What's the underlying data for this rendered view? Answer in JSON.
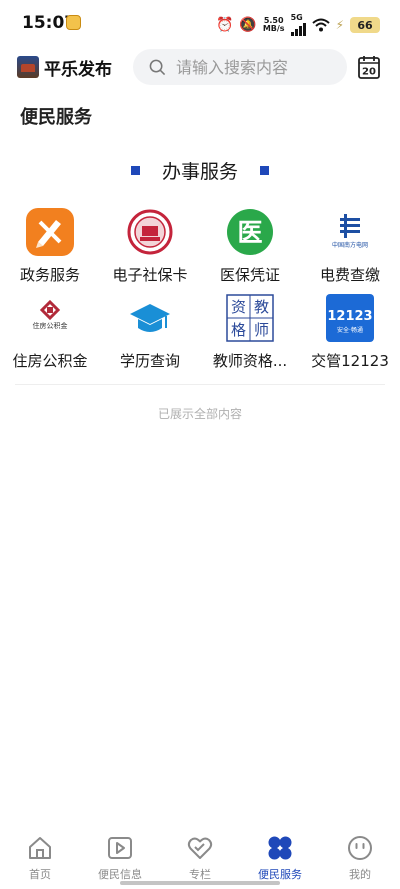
{
  "status_bar": {
    "time": "15:07",
    "net_speed": "5.50",
    "net_unit": "MB/s",
    "network_type": "5G",
    "battery": "66",
    "icons": [
      "alarm-icon",
      "mute-icon",
      "signal-icon",
      "wifi-icon",
      "battery-icon"
    ]
  },
  "header": {
    "brand": "平乐发布",
    "search_placeholder": "请输入搜索内容",
    "calendar_day": "20"
  },
  "page": {
    "section_title": "便民服务",
    "service_heading": "办事服务",
    "footer_note": "已展示全部内容"
  },
  "services": [
    {
      "label": "政务服务",
      "icon": "pen-ruler-icon",
      "color": "#f2801f"
    },
    {
      "label": "电子社保卡",
      "icon": "social-security-seal-icon",
      "color": "#c4243b"
    },
    {
      "label": "医保凭证",
      "icon": "medical-insurance-icon",
      "color": "#2aa84a",
      "glyph": "医"
    },
    {
      "label": "电费查缴",
      "icon": "china-southern-grid-icon",
      "color": "#1d4fa3",
      "caption": "中国南方电网"
    },
    {
      "label": "住房公积金",
      "icon": "housing-fund-icon",
      "color": "#b22a3a",
      "caption": "住房公积金"
    },
    {
      "label": "学历查询",
      "icon": "graduation-cap-icon",
      "color": "#1a8fd6"
    },
    {
      "label": "教师资格...",
      "icon": "teacher-qualification-icon",
      "color": "#2c4a9a",
      "glyph_chars": [
        "资",
        "教",
        "格",
        "师"
      ]
    },
    {
      "label": "交管12123",
      "icon": "traffic-12123-icon",
      "color": "#1c6ad6",
      "glyph": "12123",
      "caption": "安全·畅通"
    }
  ],
  "tabs": [
    {
      "label": "首页",
      "icon": "home-icon",
      "active": false
    },
    {
      "label": "便民信息",
      "icon": "play-icon",
      "active": false
    },
    {
      "label": "专栏",
      "icon": "heart-icon",
      "active": false
    },
    {
      "label": "便民服务",
      "icon": "clover-icon",
      "active": true
    },
    {
      "label": "我的",
      "icon": "smile-icon",
      "active": false
    }
  ],
  "colors": {
    "accent": "#1f48b9",
    "search_bg": "#f2f3f5",
    "inactive": "#8a8a8a"
  }
}
